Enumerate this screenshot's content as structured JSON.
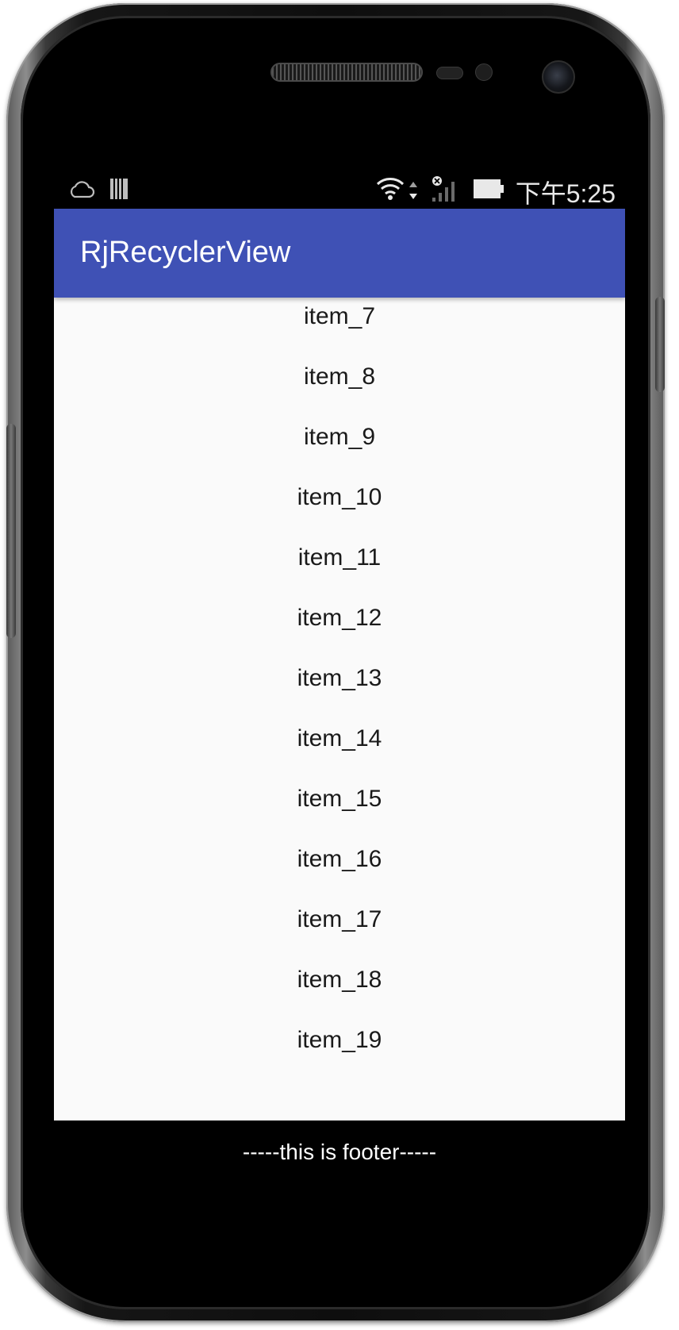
{
  "status_bar": {
    "time": "下午5:25",
    "icons": [
      "cloud-icon",
      "storage-icon",
      "wifi-icon",
      "data-arrows-icon",
      "signal-icon",
      "battery-icon"
    ]
  },
  "app_bar": {
    "title": "RjRecyclerView",
    "color": "#3f51b5"
  },
  "list": {
    "items": [
      "item_7",
      "item_8",
      "item_9",
      "item_10",
      "item_11",
      "item_12",
      "item_13",
      "item_14",
      "item_15",
      "item_16",
      "item_17",
      "item_18",
      "item_19"
    ]
  },
  "footer": {
    "text": "-----this is footer-----"
  }
}
